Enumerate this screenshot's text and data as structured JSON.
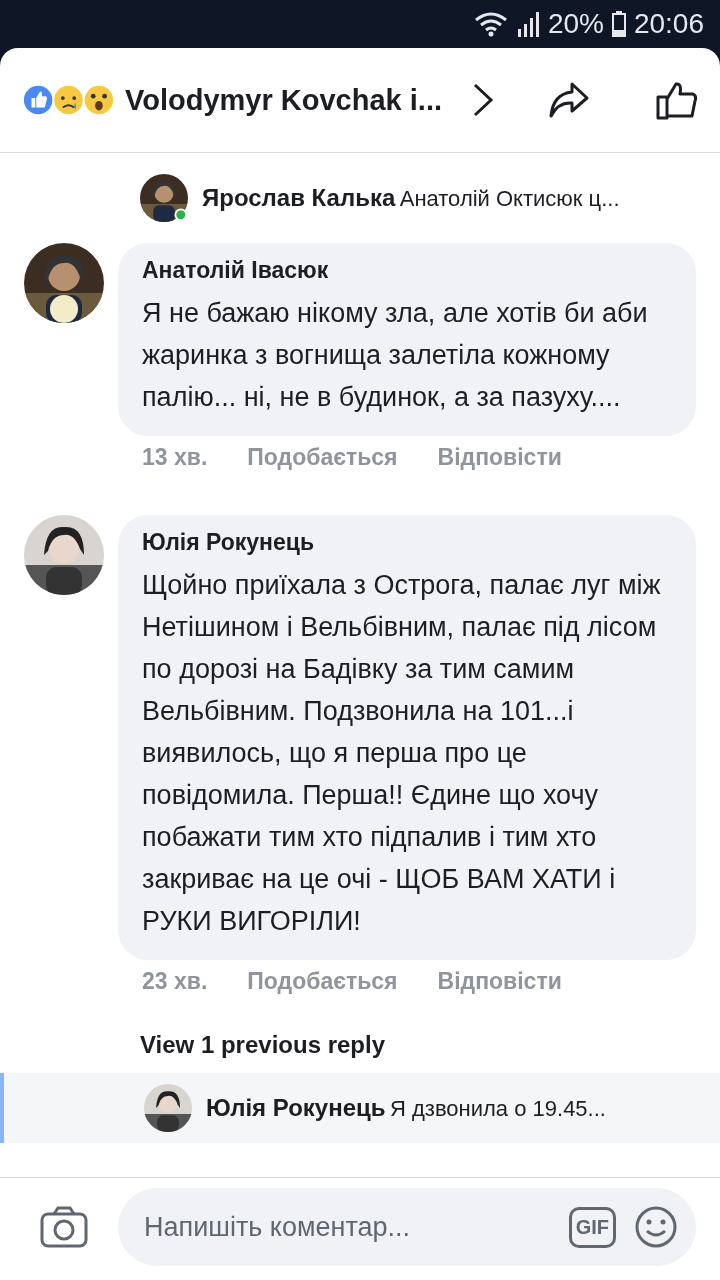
{
  "status_bar": {
    "battery": "20%",
    "time": "20:06"
  },
  "header": {
    "title": "Volodymyr Kovchak і..."
  },
  "top_reply": {
    "author": "Ярослав Калька",
    "text": "Анатолій Октисюк ц...",
    "online": true
  },
  "comments": [
    {
      "author": "Анатолій Івасюк",
      "text": "Я не бажаю нікому зла, але хотів би аби жаринка з вогнища залетіла кожному палію... ні, не в будинок, а за пазуху....",
      "time": "13 хв.",
      "like": "Подобається",
      "reply": "Відповісти"
    },
    {
      "author": "Юлія Рокунець",
      "text": "Щойно приїхала з Острога, палає луг між Нетішином і Вельбівним, палає під лісом по дорозі на Бадівку за тим самим Вельбівним. Подзвонила на 101...і виявилось, що я перша про це повідомила. Перша!! Єдине що хочу побажати тим хто підпалив і тим хто закриває на це очі - ЩОБ ВАМ ХАТИ і РУКИ ВИГОРІЛИ!",
      "time": "23 хв.",
      "like": "Подобається",
      "reply": "Відповісти"
    }
  ],
  "view_previous": "View 1 previous reply",
  "bottom_reply": {
    "author": "Юлія Рокунець",
    "text": "Я дзвонила о 19.45...",
    "online": false
  },
  "composer": {
    "placeholder": "Напишіть коментар...",
    "gif": "GIF"
  }
}
